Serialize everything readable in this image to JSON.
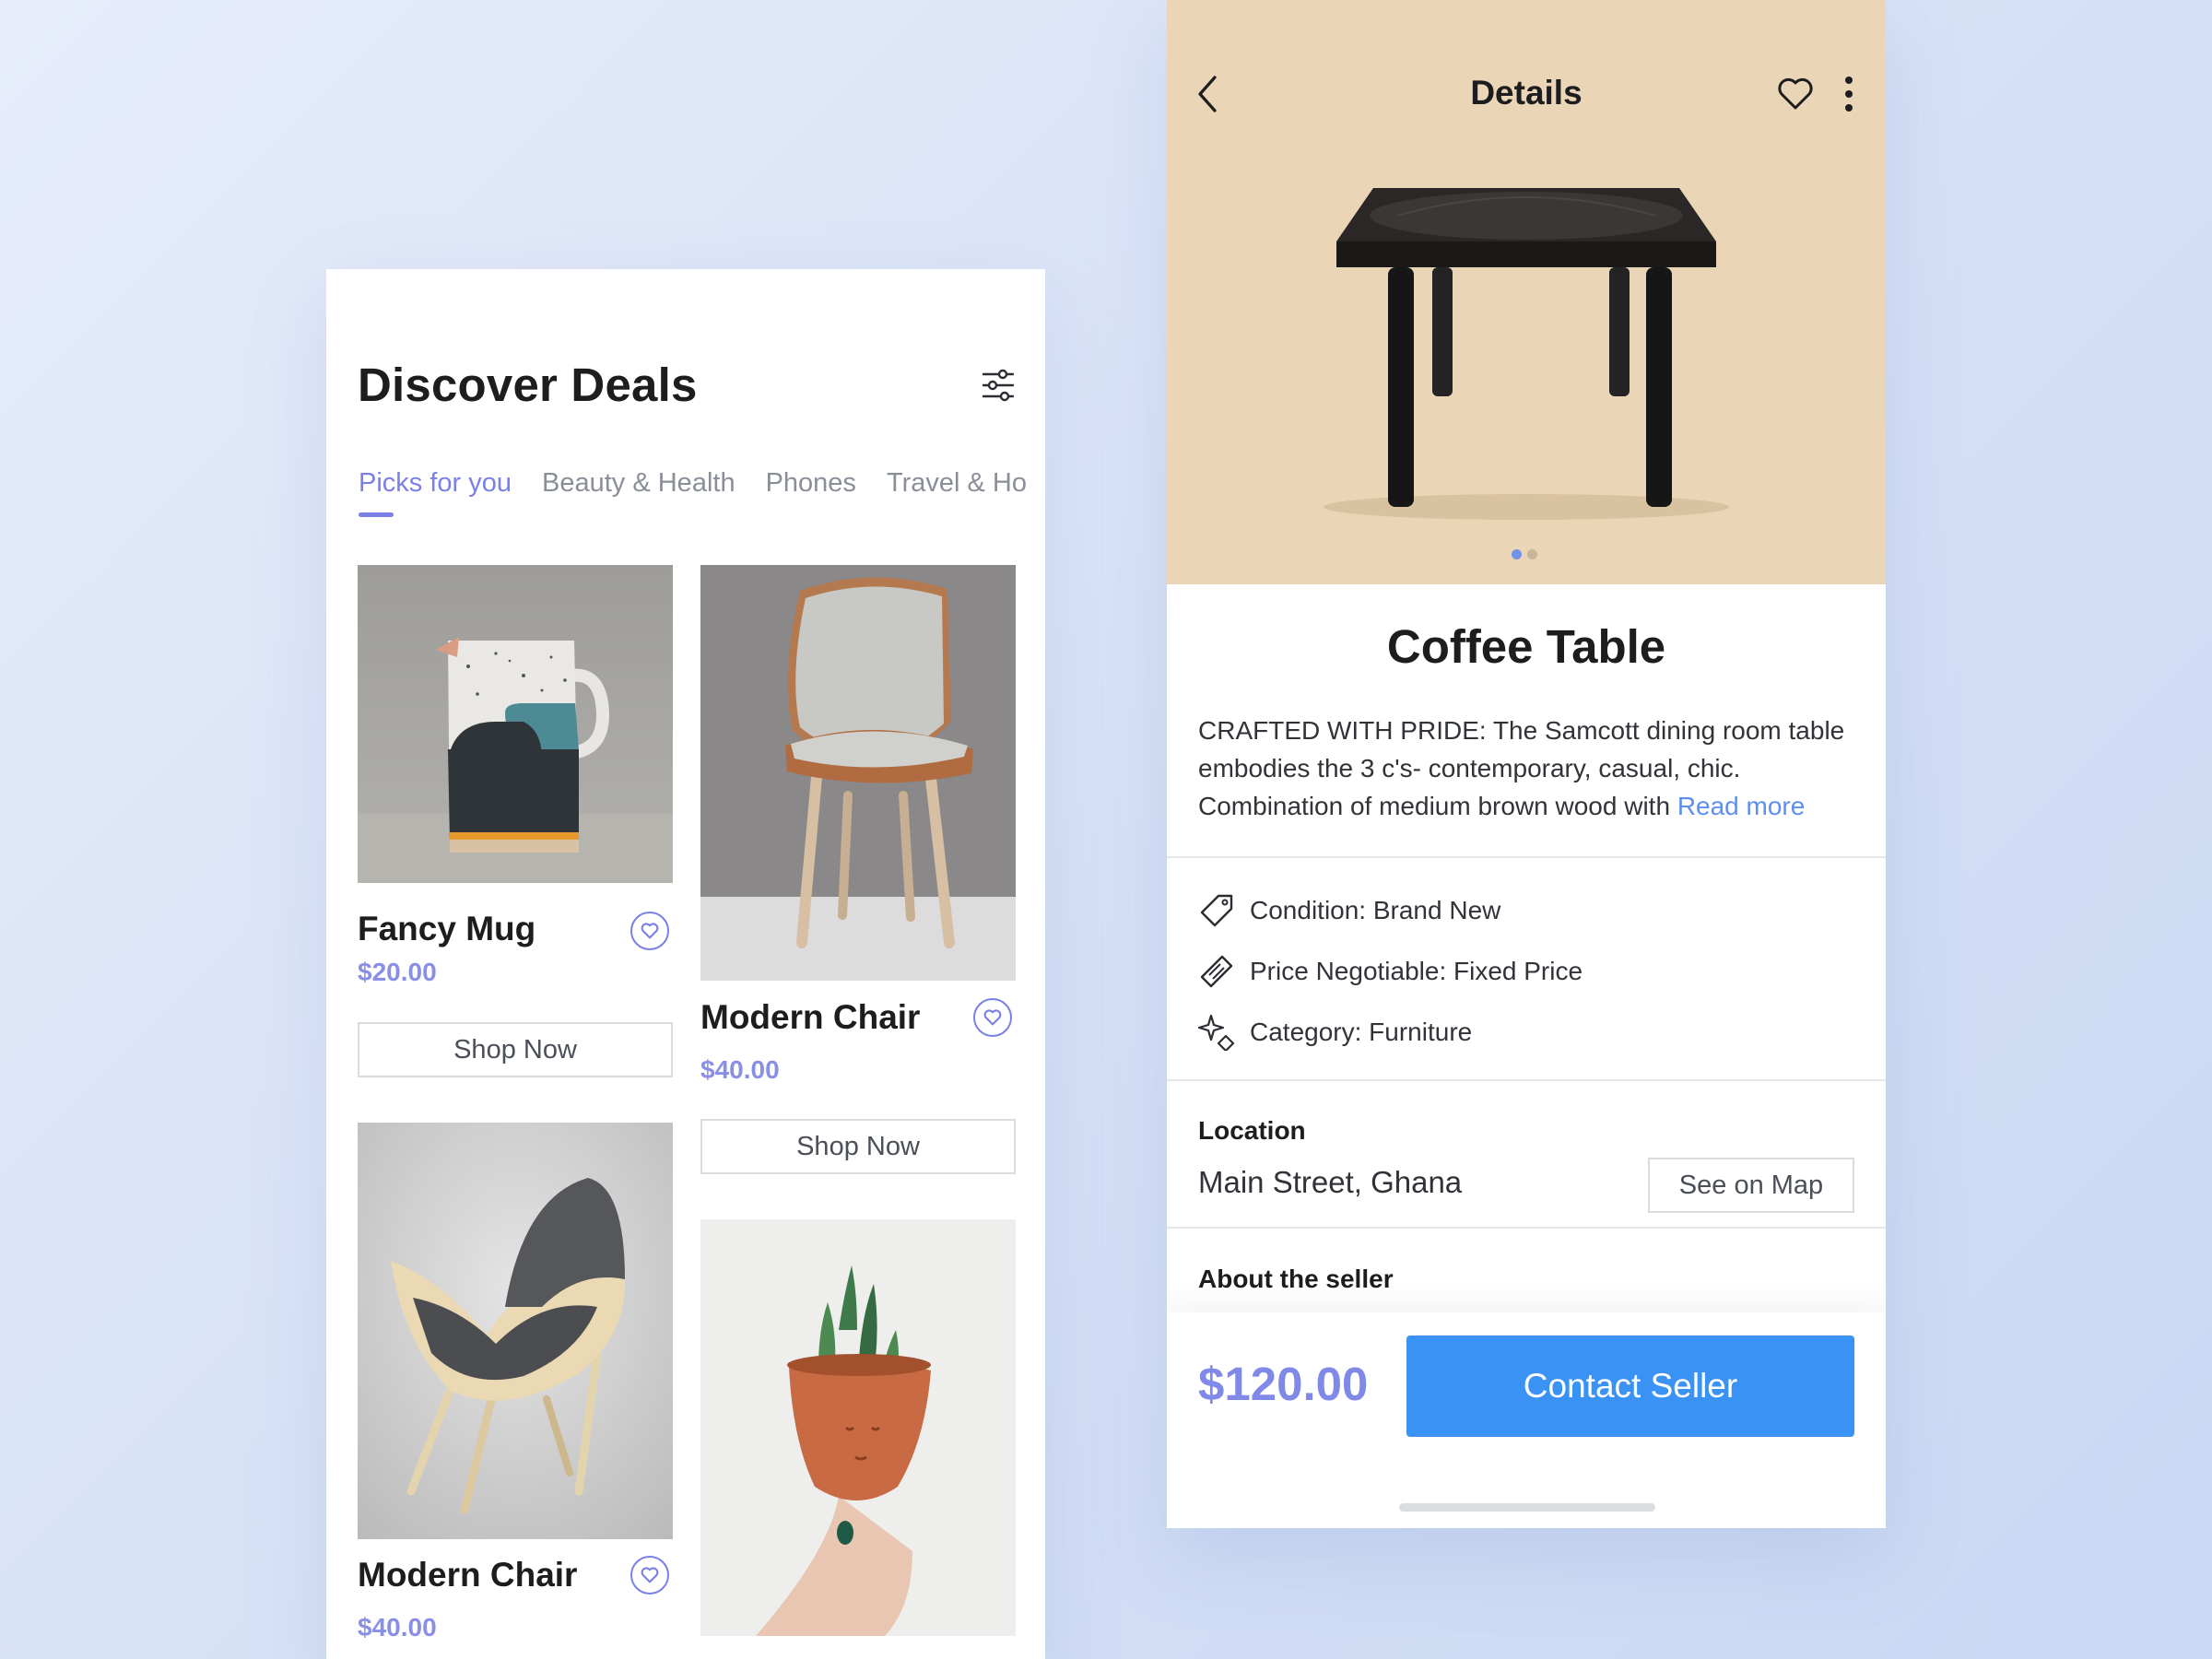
{
  "left": {
    "title": "Discover Deals",
    "tabs": [
      {
        "label": "Picks for you",
        "active": true
      },
      {
        "label": "Beauty & Health",
        "active": false
      },
      {
        "label": "Phones",
        "active": false
      },
      {
        "label": "Travel & Ho",
        "active": false
      }
    ],
    "products": [
      {
        "name": "Fancy Mug",
        "price": "$20.00",
        "button": "Shop Now"
      },
      {
        "name": "Modern Chair",
        "price": "$40.00",
        "button": "Shop Now"
      },
      {
        "name": "Modern Chair",
        "price": "$40.00"
      }
    ]
  },
  "right": {
    "header": {
      "title": "Details"
    },
    "product": {
      "title": "Coffee Table",
      "description": "CRAFTED WITH PRIDE: The Samcott dining room table embodies the 3 c's- contemporary, casual, chic. Combination of medium brown wood with",
      "read_more": "Read more"
    },
    "attributes": [
      {
        "icon": "tag-icon",
        "text": "Condition: Brand New"
      },
      {
        "icon": "ticket-icon",
        "text": "Price Negotiable: Fixed Price"
      },
      {
        "icon": "sparkle-icon",
        "text": "Category: Furniture"
      }
    ],
    "location": {
      "label": "Location",
      "value": "Main Street, Ghana",
      "button": "See on Map"
    },
    "seller": {
      "label": "About the seller"
    },
    "footer": {
      "price": "$120.00",
      "button": "Contact Seller"
    }
  },
  "colors": {
    "accent": "#7a80e6",
    "primary_button": "#3a92f5",
    "hero_bg": "#ead5b6",
    "link": "#5d8ff0"
  }
}
